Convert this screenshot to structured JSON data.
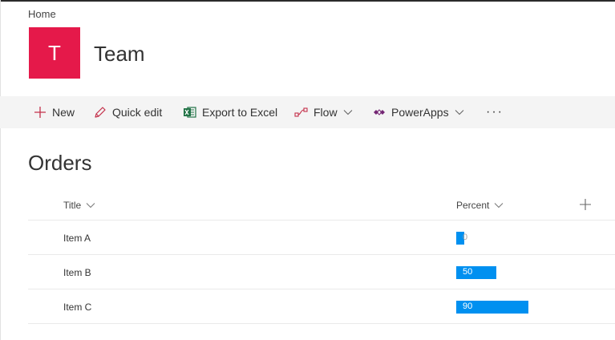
{
  "breadcrumb": {
    "home": "Home"
  },
  "site": {
    "logo_letter": "T",
    "title": "Team",
    "logo_color": "#e5194a"
  },
  "commandbar": {
    "new": "New",
    "quick_edit": "Quick edit",
    "export": "Export to Excel",
    "flow": "Flow",
    "powerapps": "PowerApps",
    "more": "···"
  },
  "list": {
    "title": "Orders",
    "columns": {
      "title": "Title",
      "percent": "Percent"
    },
    "rows": [
      {
        "title": "Item A",
        "percent": 0,
        "label": "0"
      },
      {
        "title": "Item B",
        "percent": 50,
        "label": "50"
      },
      {
        "title": "Item C",
        "percent": 90,
        "label": "90"
      }
    ],
    "bar_color": "#0090f0"
  }
}
